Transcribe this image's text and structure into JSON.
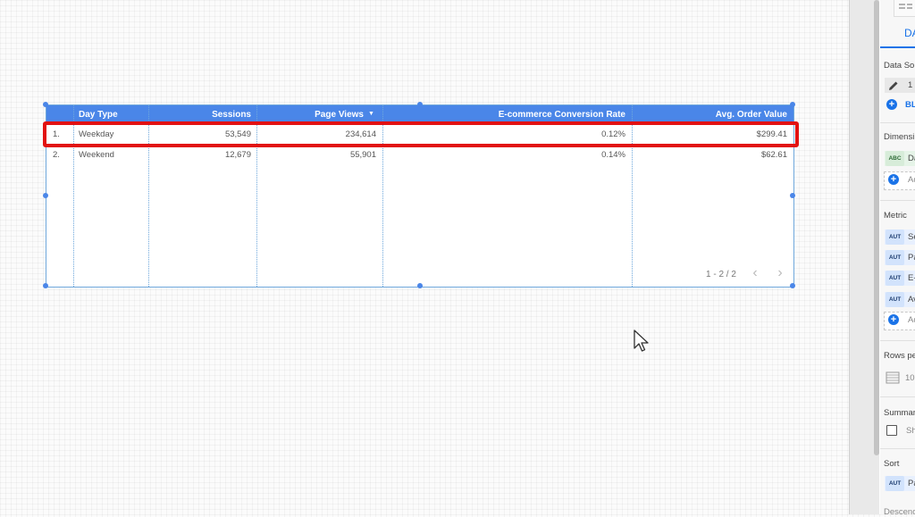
{
  "table": {
    "columns": [
      {
        "label": "Day Type"
      },
      {
        "label": "Sessions"
      },
      {
        "label": "Page Views"
      },
      {
        "label": "E-commerce Conversion Rate"
      },
      {
        "label": "Avg. Order Value"
      }
    ],
    "sort_indicator": "▼",
    "rows": [
      {
        "index": "1.",
        "day_type": "Weekday",
        "sessions": "53,549",
        "page_views": "234,614",
        "conversion_rate": "0.12%",
        "avg_order_value": "$299.41"
      },
      {
        "index": "2.",
        "day_type": "Weekend",
        "sessions": "12,679",
        "page_views": "55,901",
        "conversion_rate": "0.14%",
        "avg_order_value": "$62.61"
      }
    ],
    "pagination": "1 - 2 / 2",
    "prev_icon": "‹",
    "next_icon": "›"
  },
  "panel": {
    "tab_label": "DA",
    "data_source_label": "Data Sou",
    "data_source_value": "1",
    "blend_label": "BL",
    "dimension_label": "Dimensi",
    "dimension_chip_type": "ABC",
    "dimension_chip_text": "Da",
    "add_dimension_label": "Ad",
    "metric_label": "Metric",
    "metrics": [
      {
        "type": "AUT",
        "text": "Se"
      },
      {
        "type": "AUT",
        "text": "Pa"
      },
      {
        "type": "AUT",
        "text": "E-"
      },
      {
        "type": "AUT",
        "text": "Av"
      }
    ],
    "add_metric_label": "Ad",
    "rows_per_page_label": "Rows pe",
    "rows_per_page_value": "10",
    "summary_label": "Summar",
    "summary_checkbox_label": "Sh",
    "sort_label": "Sort",
    "sort_chip_type": "AUT",
    "sort_chip_text": "Pa",
    "descending_label": "Descend"
  },
  "colors": {
    "header_blue": "#4a86e8",
    "highlight_red": "#e21212",
    "accent_blue": "#1a73e8"
  }
}
